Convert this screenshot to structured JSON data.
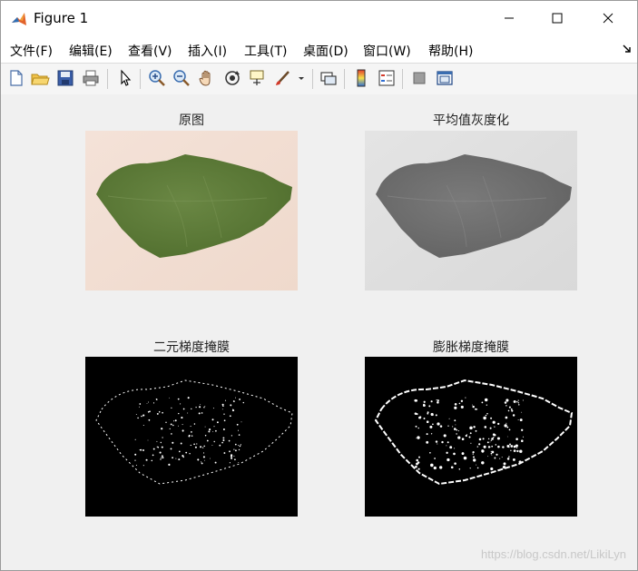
{
  "window": {
    "title": "Figure 1"
  },
  "menu": {
    "items": [
      "文件(F)",
      "编辑(E)",
      "查看(V)",
      "插入(I)",
      "工具(T)",
      "桌面(D)",
      "窗口(W)",
      "帮助(H)"
    ]
  },
  "toolbar": {
    "icons": [
      "new-figure",
      "open-file",
      "save",
      "print",
      "pointer",
      "zoom-in",
      "zoom-out",
      "pan",
      "rotate-3d",
      "data-cursor",
      "brush",
      "link-plot",
      "colorbar",
      "legend",
      "hide-plot-tools",
      "show-plot-tools"
    ]
  },
  "figure": {
    "subplots": [
      {
        "title": "原图",
        "kind": "rgb-leaf"
      },
      {
        "title": "平均值灰度化",
        "kind": "gray-leaf"
      },
      {
        "title": "二元梯度掩膜",
        "kind": "binary-edge"
      },
      {
        "title": "膨胀梯度掩膜",
        "kind": "dilated-edge"
      }
    ]
  },
  "watermark": "https://blog.csdn.net/LikiLyn",
  "colors": {
    "window_bg": "#f0f0f0",
    "leaf_green": "#5e7a3c",
    "paper_pink": "#f1ddd3",
    "gray_bg": "#e1e1e1",
    "gray_leaf": "#6e6e6e"
  }
}
